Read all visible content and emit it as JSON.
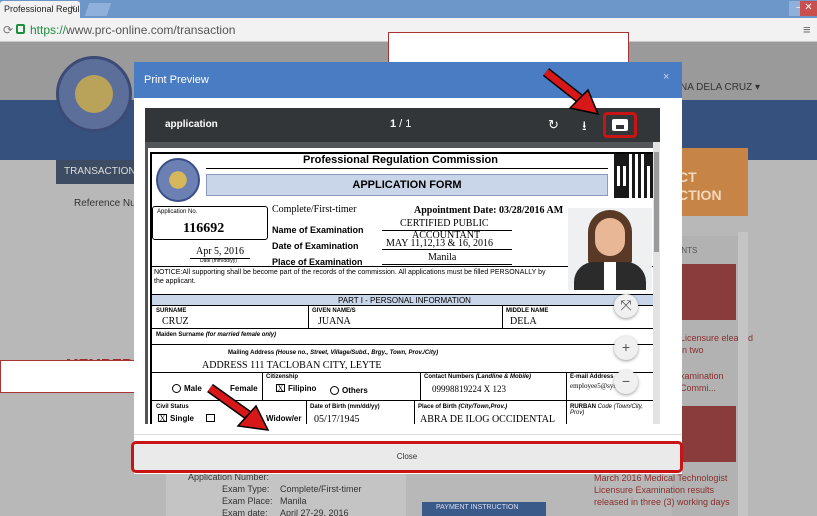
{
  "browser": {
    "tab_title": "Professional Regulation C",
    "tab_close": "×",
    "url_scheme": "https://",
    "url_rest": "www.prc-online.com/transaction"
  },
  "site": {
    "user_name": "NA DELA CRUZ ▾",
    "transactions_tab": "TRANSACTIONS",
    "reference_label": "Reference Num",
    "memo_fragment": "MEMBERSHI",
    "orange_banner": [
      "CT",
      "CTION"
    ],
    "rightcol_label": "ENTS",
    "result_text_1": "Licensure eleased in two",
    "result_text_2": "xamination Commi...",
    "news_text": "March 2016 Medical Technologist Licensure Examination results released in three (3) working days",
    "info_rows": [
      {
        "label": "Application Number:",
        "value": ""
      },
      {
        "label": "Exam Type:",
        "value": "Complete/First-timer"
      },
      {
        "label": "Exam Place:",
        "value": "Manila"
      },
      {
        "label": "Exam date:",
        "value": "April 27-29, 2016"
      }
    ],
    "payment_instruction": "PAYMENT INSTRUCTION"
  },
  "modal": {
    "title": "Print Preview",
    "close_x": "×",
    "close_button": "Close"
  },
  "viewer": {
    "doc_name": "application",
    "page_current": "1",
    "page_total": "1",
    "rotate_icon": "rotate-icon",
    "download_icon": "download-icon",
    "print_icon": "print-icon"
  },
  "document": {
    "header": "Professional Regulation Commission",
    "form_title": "APPLICATION FORM",
    "application_no_label": "Application No.",
    "application_no": "116692",
    "applicant_type": "Complete/First-timer",
    "appointment_date": "Appointment Date: 03/28/2016 AM",
    "name_of_exam_label": "Name of Examination",
    "name_of_exam_value_1": "CERTIFIED PUBLIC",
    "name_of_exam_value_2": "ACCOUNTANT",
    "date_of_exam_label": "Date of Examination",
    "date_of_exam_value": "MAY 11,12,13 & 16, 2016",
    "place_of_exam_label": "Place of Examination",
    "place_of_exam_value": "Manila",
    "date_signed": "Apr 5, 2016",
    "date_format": "Date (mm/dd/yy)",
    "notice": "NOTICE:All supporting shall be become part of the records of the commission. All applications must be filled PERSONALLY by the applicant.",
    "section_title": "PART I - PERSONAL INFORMATION",
    "surname_label": "SURNAME",
    "surname": "CRUZ",
    "given_label": "GIVEN NAME/S",
    "given": "JUANA",
    "middle_label": "MIDDLE NAME",
    "middle": "DELA",
    "maiden_label": "Maiden Surname",
    "maiden_note": "(for married female only)",
    "address_label": "Mailing Address",
    "address_note": "(House no., Street, Village/Subd., Brgy., Town, Prov./City)",
    "address_value": "ADDRESS 111 TACLOBAN CITY, LEYTE",
    "sex_male": "Male",
    "sex_female": "Female",
    "citizenship_label": "Citizenship",
    "citizenship_filipino": "Filipino",
    "citizenship_others": "Others",
    "contact_label": "Contact Numbers",
    "contact_note": "(Landline & Mobile)",
    "contact_value": "09998819224 X 123",
    "email_label": "E-mail Address",
    "email_value": "employee5@sysho.com",
    "civil_label": "Civil Status",
    "civil_single": "Single",
    "civil_widow": "Widow/er",
    "dob_label": "Date of Birth (mm/dd/yy)",
    "dob_value": "05/17/1945",
    "pob_label": "Place of Birth",
    "pob_note": "(City/Town,Prov.)",
    "pob_value": "ABRA DE ILOG OCCIDENTAL",
    "rurban_label": "RURBAN",
    "rurban_note": "Code (Town/City, Prov)"
  },
  "colors": {
    "modal_header": "#4a7cc4",
    "highlight": "#c81414",
    "viewer_toolbar": "#323639"
  }
}
